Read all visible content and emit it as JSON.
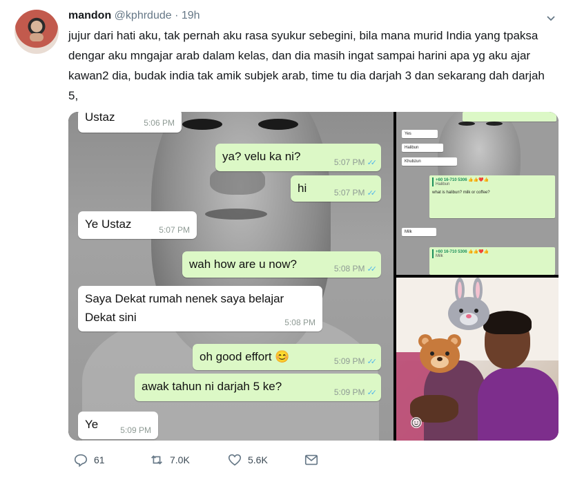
{
  "tweet": {
    "author_name": "mandon",
    "handle": "@kphrdude",
    "separator": "·",
    "time": "19h",
    "text": "jujur dari hati aku, tak pernah aku rasa syukur sebegini, bila mana murid India yang tpaksa dengar aku mngajar arab dalam kelas, dan dia masih ingat sampai harini apa yg aku ajar kawan2 dia, budak india tak amik subjek arab, time tu dia darjah 3 dan sekarang dah darjah 5,"
  },
  "chat_main": [
    {
      "dir": "in",
      "text": "Ustaz",
      "time": "5:06 PM"
    },
    {
      "dir": "out",
      "text": "ya? velu ka ni?",
      "time": "5:07 PM"
    },
    {
      "dir": "out",
      "text": "hi",
      "time": "5:07 PM"
    },
    {
      "dir": "in",
      "text": "Ye Ustaz",
      "time": "5:07 PM"
    },
    {
      "dir": "out",
      "text": "wah how are u now?",
      "time": "5:08 PM"
    },
    {
      "dir": "in",
      "text": "Saya Dekat rumah nenek saya belajar",
      "text2": "Dekat sini",
      "time": "5:08 PM"
    },
    {
      "dir": "out",
      "text": "oh good effort 😊",
      "time": "5:09 PM"
    },
    {
      "dir": "out",
      "text": "awak tahun ni darjah 5 ke?",
      "time": "5:09 PM"
    },
    {
      "dir": "in",
      "text": "Ye",
      "time": "5:09 PM"
    }
  ],
  "chat_small": {
    "msg1": "Yes",
    "msg2": "Halibun",
    "msg3": "Khubzun",
    "quote_phone": "+60 16-710 5306",
    "quote_emoji": "👍👍❤️👍",
    "quote_text": "Halibun",
    "reply": "what is halibun? milk or coffee?",
    "msg4": "Milk",
    "quote2_phone": "+60 16-710 5306",
    "quote2_emoji": "👍👍❤️👍",
    "quote2_text": "Milk"
  },
  "actions": {
    "replies": "61",
    "retweets": "7.0K",
    "likes": "5.6K"
  },
  "colors": {
    "bubble_out": "#dcf8c6",
    "bubble_in": "#ffffff",
    "read_tick": "#4fb6ec",
    "meta_gray": "#657786"
  }
}
